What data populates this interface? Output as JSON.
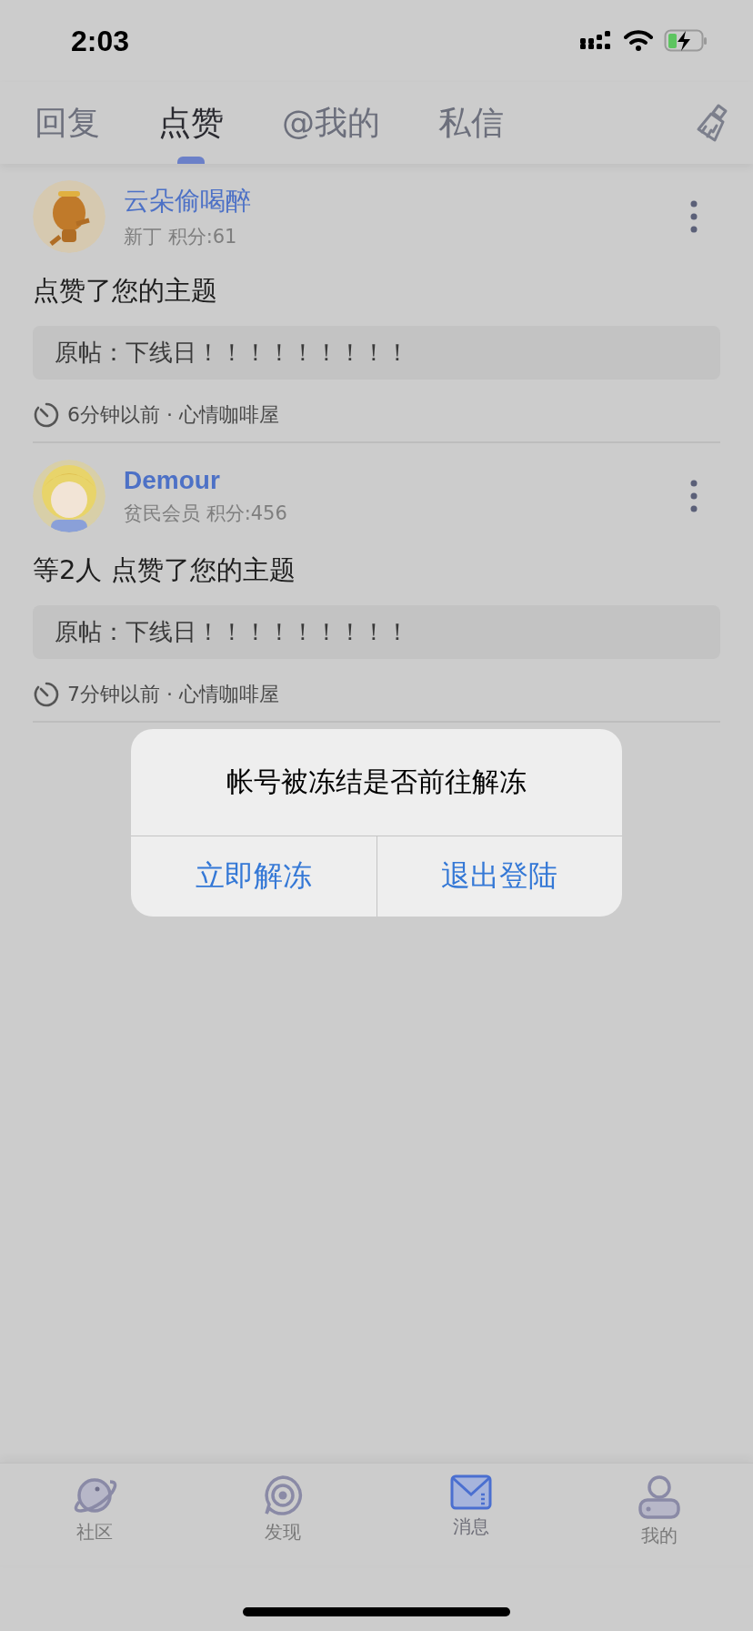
{
  "status_bar": {
    "time": "2:03"
  },
  "tabs": [
    {
      "label": "回复",
      "selected": false
    },
    {
      "label": "点赞",
      "selected": true
    },
    {
      "label": "@我的",
      "selected": false
    },
    {
      "label": "私信",
      "selected": false
    }
  ],
  "posts": [
    {
      "user": "云朵偷喝醉",
      "info": "新丁 积分:61",
      "action": "点赞了您的主题",
      "quote": "原帖：下线日！！！！！！！！！",
      "meta": "6分钟以前 · 心情咖啡屋"
    },
    {
      "user": "Demour",
      "info": "贫民会员 积分:456",
      "action": "等2人 点赞了您的主题",
      "quote": "原帖：下线日！！！！！！！！！",
      "meta": "7分钟以前 · 心情咖啡屋"
    }
  ],
  "dialog": {
    "title": "帐号被冻结是否前往解冻",
    "buttons": [
      "立即解冻",
      "退出登陆"
    ]
  },
  "bottom_tabs": [
    {
      "label": "社区",
      "selected": false
    },
    {
      "label": "发现",
      "selected": false
    },
    {
      "label": "消息",
      "selected": true
    },
    {
      "label": "我的",
      "selected": false
    }
  ]
}
